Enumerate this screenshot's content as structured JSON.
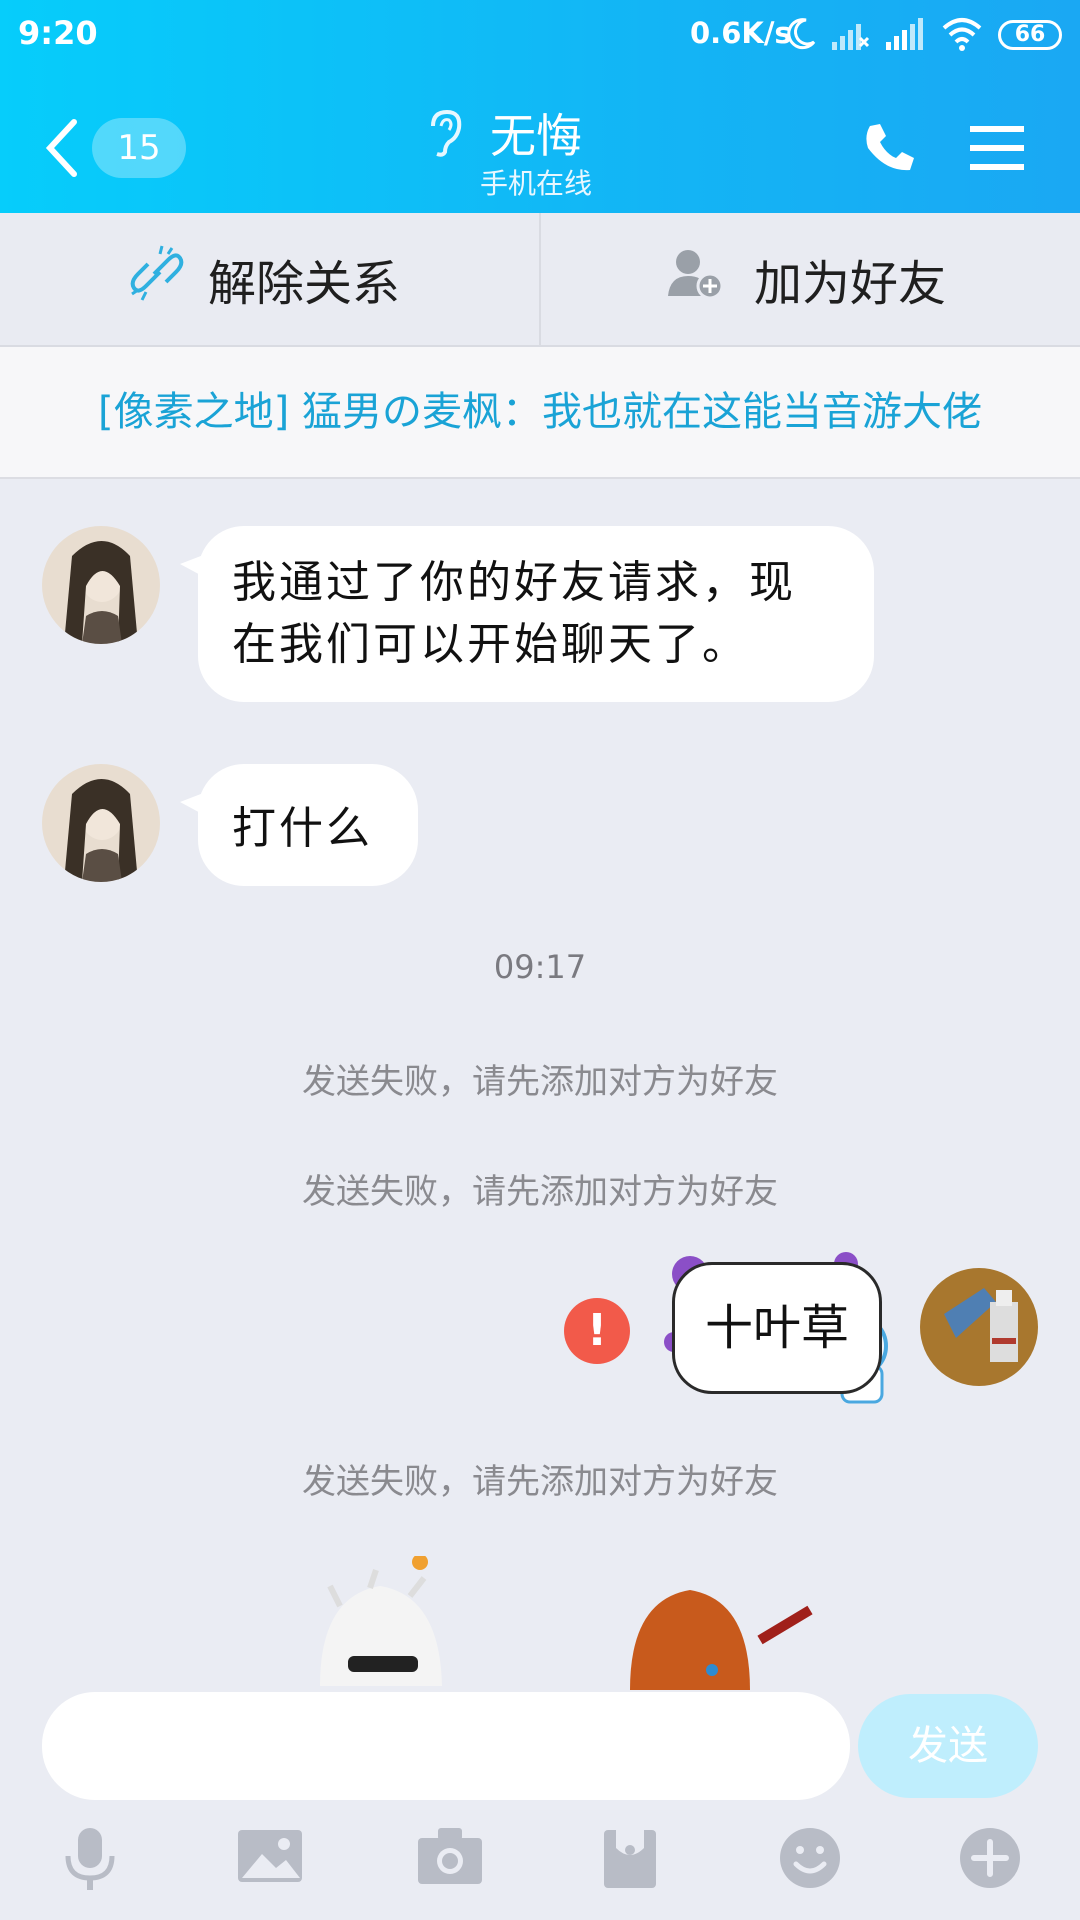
{
  "status": {
    "time": "9:20",
    "speed": "0.6K/s",
    "battery": "66"
  },
  "header": {
    "unread": "15",
    "title": "无悔",
    "subtitle": "手机在线"
  },
  "actions": {
    "remove": "解除关系",
    "add": "加为好友"
  },
  "notice": "[像素之地] 猛男の麦枫：我也就在这能当音游大佬",
  "messages": {
    "m1_line1": "我通过了你的好友请求，现",
    "m1_line2": "在我们可以开始聊天了。",
    "m2": "打什么",
    "time": "09:17",
    "fail1": "发送失败，请先添加对方为好友",
    "fail2": "发送失败，请先添加对方为好友",
    "sticker": "十叶草",
    "fail3": "发送失败，请先添加对方为好友"
  },
  "composer": {
    "placeholder": "",
    "send": "发送"
  },
  "icons": [
    "microphone-icon",
    "image-icon",
    "camera-icon",
    "folder-icon",
    "emoji-icon",
    "plus-icon"
  ]
}
